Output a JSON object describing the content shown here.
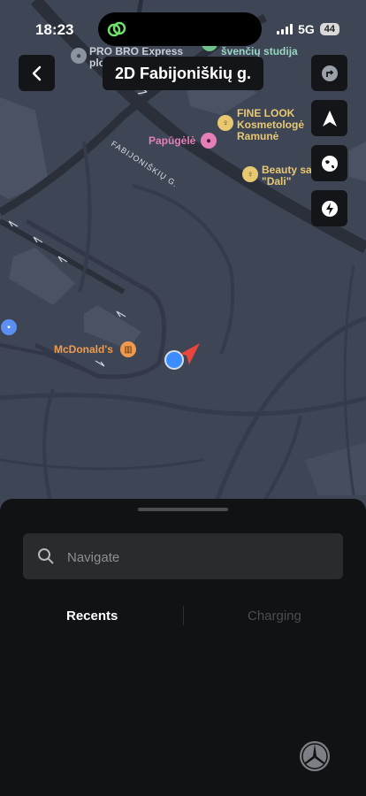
{
  "status": {
    "time": "18:23",
    "network": "5G",
    "battery": "44"
  },
  "header": {
    "address": "2D Fabijoniškių g."
  },
  "map": {
    "street": "FABIJONIŠKIŲ G.",
    "pois": [
      {
        "name": "PRO BRO Express plo"
      },
      {
        "name": "švenčių studija"
      },
      {
        "name": "FINE LOOK Kosmetologė Ramunė"
      },
      {
        "name": "Papūgėlė"
      },
      {
        "name": "Beauty sa \"Dali\""
      },
      {
        "name": "McDonald's"
      }
    ],
    "colors": {
      "water": "#3e4656",
      "road": "#2e3440",
      "poi_label": "#e8c871",
      "teal": "#9ad8c4",
      "pink": "#e57fb8",
      "orange": "#ef9a4d"
    }
  },
  "sheet": {
    "search_placeholder": "Navigate",
    "tabs": [
      {
        "label": "Recents"
      },
      {
        "label": "Charging"
      }
    ]
  }
}
